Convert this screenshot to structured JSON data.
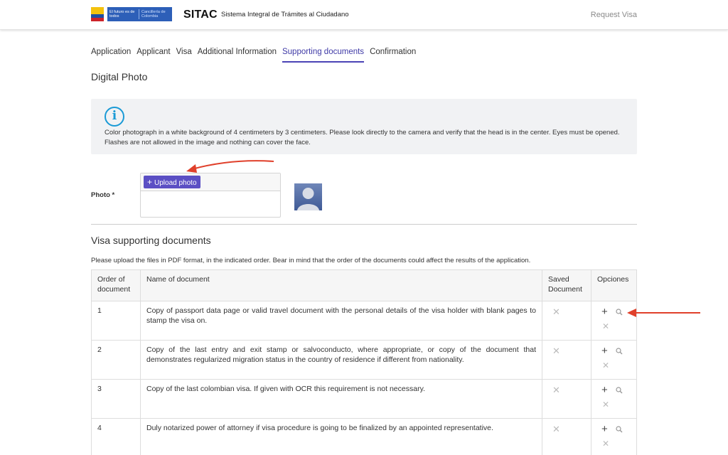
{
  "header": {
    "gov_badge_left": "El futuro es de todos",
    "gov_badge_right": "Cancillería de Colombia",
    "app_name": "SITAC",
    "app_subtitle": "Sistema Integral de Trámites al Ciudadano",
    "request_visa": "Request Visa"
  },
  "tabs": [
    {
      "label": "Application"
    },
    {
      "label": "Applicant"
    },
    {
      "label": "Visa"
    },
    {
      "label": "Additional Information"
    },
    {
      "label": "Supporting documents"
    },
    {
      "label": "Confirmation"
    }
  ],
  "active_tab": "Supporting documents",
  "digital_photo": {
    "title": "Digital Photo",
    "info_text": "Color photograph in a white background of 4 centimeters by 3 centimeters. Please look directly to the camera and verify that the head is in the center. Eyes must be opened. Flashes are not allowed in the image and nothing can cover the face.",
    "photo_label": "Photo *",
    "upload_button": "Upload photo"
  },
  "supporting_docs": {
    "title": "Visa supporting documents",
    "instructions": "Please upload the files in PDF format, in the indicated order. Bear in mind that the order of the documents could affect the results of the application.",
    "columns": [
      "Order of document",
      "Name of document",
      "Saved Document",
      "Opciones"
    ],
    "rows": [
      {
        "order": "1",
        "name": "Copy of passport data page or valid travel document with the personal details of the visa holder with blank pages to stamp the visa on."
      },
      {
        "order": "2",
        "name": "Copy of the last entry and exit stamp or salvoconducto, where appropriate, or copy of the document that demonstrates regularized migration status in the country of residence if different from nationality."
      },
      {
        "order": "3",
        "name": "Copy of the last colombian visa. If given with OCR this requirement is not necessary."
      },
      {
        "order": "4",
        "name": "Duly notarized power of attorney if visa procedure is going to be finalized by an appointed representative."
      }
    ]
  },
  "colors": {
    "accent": "#5b4fc4",
    "tab_active": "#3f3aa6",
    "info_icon": "#1a9ad6",
    "annotation_arrow": "#e0402b"
  }
}
